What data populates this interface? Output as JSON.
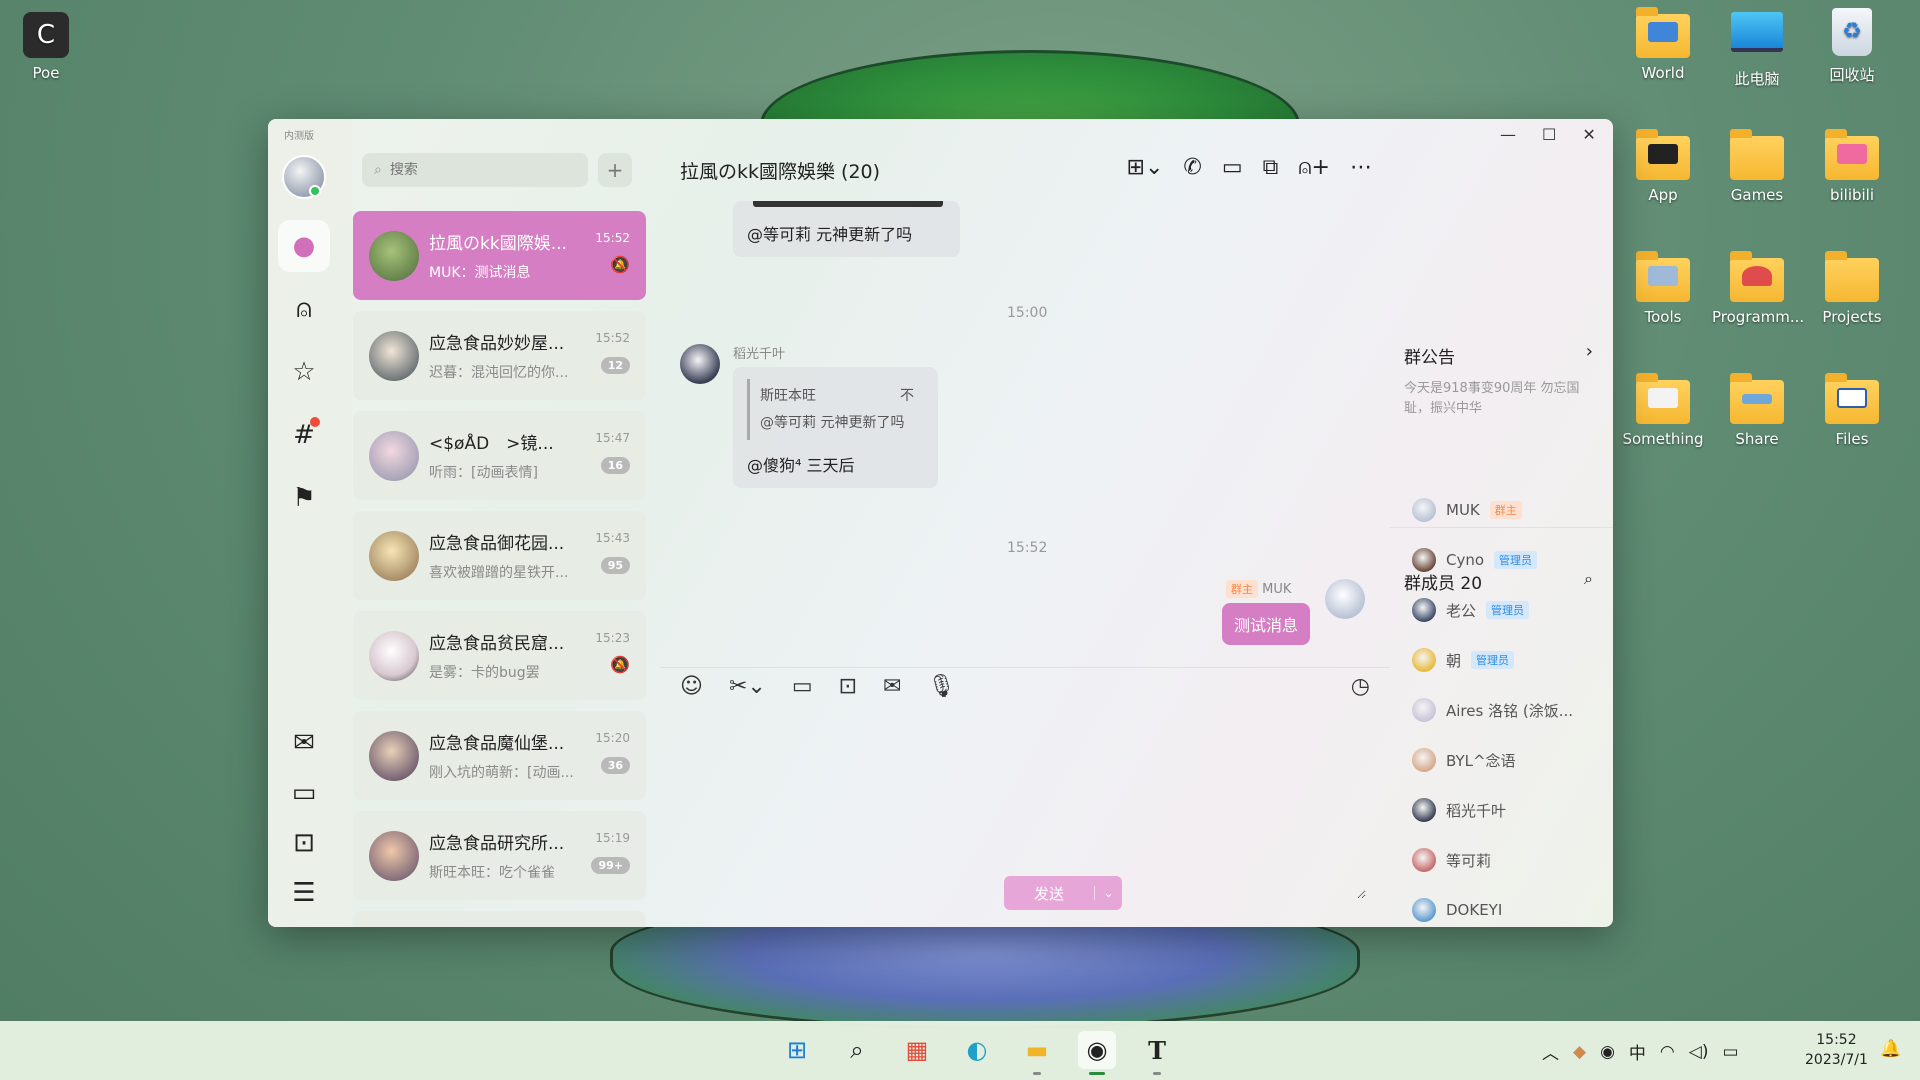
{
  "desktop": {
    "poe": {
      "letter": "C",
      "label": "Poe"
    },
    "icons": [
      {
        "label": "World"
      },
      {
        "label": "此电脑"
      },
      {
        "label": "回收站"
      },
      {
        "label": "App"
      },
      {
        "label": "Games"
      },
      {
        "label": "bilibili"
      },
      {
        "label": "Tools"
      },
      {
        "label": "Programm..."
      },
      {
        "label": "Projects"
      },
      {
        "label": "Something"
      },
      {
        "label": "Share"
      },
      {
        "label": "Files"
      }
    ]
  },
  "window": {
    "edition": "内测版",
    "search_placeholder": "搜索",
    "add_label": "+",
    "controls": {
      "minimize": "—",
      "maximize": "☐",
      "close": "✕"
    }
  },
  "conversations": [
    {
      "name": "拉風のkk國際娛...",
      "preview": "MUK：测试消息",
      "time": "15:52",
      "badge": "",
      "muted": true,
      "active": true
    },
    {
      "name": "应急食品妙妙屋...",
      "preview": "迟暮：混沌回忆的你...",
      "time": "15:52",
      "badge": "12",
      "muted": false
    },
    {
      "name": "<$øÅD　>镜...",
      "preview": "听雨：[动画表情]",
      "time": "15:47",
      "badge": "16",
      "muted": false
    },
    {
      "name": "应急食品御花园...",
      "preview": "喜欢被蹭蹭的星铁开...",
      "time": "15:43",
      "badge": "95",
      "muted": false
    },
    {
      "name": "应急食品贫民窟...",
      "preview": "是雾：卡的bug罢",
      "time": "15:23",
      "badge": "",
      "muted": true
    },
    {
      "name": "应急食品魔仙堡...",
      "preview": "刚入坑的萌新：[动画...",
      "time": "15:20",
      "badge": "36",
      "muted": false
    },
    {
      "name": "应急食品研究所...",
      "preview": "斯旺本旺：吃个雀雀",
      "time": "15:19",
      "badge": "99+",
      "muted": false
    }
  ],
  "chat": {
    "title": "拉風のkk國際娛樂 (20)",
    "msg_top": "@等可莉 元神更新了吗",
    "time1": "15:00",
    "sender2": "稻光千叶",
    "quote_author": "斯旺本旺",
    "quote_flag": "不",
    "quote_text": "@等可莉 元神更新了吗",
    "msg2": "@傻狗⁴ 三天后",
    "time2": "15:52",
    "my_role": "群主",
    "my_name": "MUK",
    "my_msg": "测试消息",
    "send_label": "发送",
    "send_dropdown": "⌄"
  },
  "side": {
    "notice_title": "群公告",
    "notice_text": "今天是918事变90周年 勿忘国耻，振兴中华",
    "members_title": "群成员 20",
    "members": [
      {
        "name": "MUK",
        "role": "群主",
        "role_type": "owner",
        "color": "#b9c3d6"
      },
      {
        "name": "Cyno",
        "role": "管理员",
        "role_type": "admin",
        "color": "#6b4a3a"
      },
      {
        "name": "老公",
        "role": "管理员",
        "role_type": "admin",
        "color": "#3d4a6a"
      },
      {
        "name": "朝",
        "role": "管理员",
        "role_type": "admin",
        "color": "#e8b93a"
      },
      {
        "name": "Aires 洛铭 (涂饭...",
        "role": "",
        "role_type": "",
        "color": "#c9c4d8"
      },
      {
        "name": "BYL^念语",
        "role": "",
        "role_type": "",
        "color": "#d6a88a"
      },
      {
        "name": "稻光千叶",
        "role": "",
        "role_type": "",
        "color": "#3a3f55"
      },
      {
        "name": "等可莉",
        "role": "",
        "role_type": "",
        "color": "#c86a6a"
      },
      {
        "name": "DOKEYI",
        "role": "",
        "role_type": "",
        "color": "#5f9bd0"
      }
    ]
  },
  "taskbar": {
    "tray_ime": "中",
    "time": "15:52",
    "date": "2023/7/1"
  },
  "colors": {
    "accent": "#d67ec4",
    "send_disabled": "#e7a6d8",
    "owner_tag": "#f38a4a",
    "admin_tag": "#2f8be0"
  }
}
